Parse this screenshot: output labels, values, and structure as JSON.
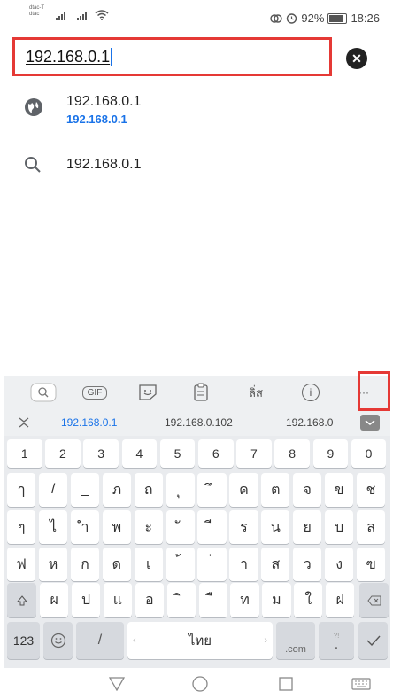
{
  "status_bar": {
    "carrier_top": "dtac-T",
    "carrier_bottom": "dtac",
    "battery_percent": "92%",
    "time": "18:26",
    "icons": [
      "signal-icon",
      "wifi-icon",
      "link-icon",
      "alarm-icon",
      "battery-icon"
    ]
  },
  "url_bar": {
    "value": "192.168.0.1",
    "clear_icon": "clear-icon",
    "highlight_color": "#e53935"
  },
  "suggestions": [
    {
      "icon": "globe-icon",
      "title": "192.168.0.1",
      "url": "192.168.0.1"
    },
    {
      "icon": "search-icon",
      "title": "192.168.0.1"
    }
  ],
  "keyboard": {
    "toolbar": {
      "gif_label": "GIF",
      "translate_label": "ลิ่ส",
      "info_label": "i",
      "more_label": "···",
      "icons": [
        "search-icon",
        "gif-icon",
        "sticker-icon",
        "clipboard-icon",
        "translate-icon",
        "info-icon",
        "more-icon"
      ]
    },
    "predictions": [
      "192.168.0.1",
      "192.168.0.102",
      "192.168.0.1"
    ],
    "number_row": [
      "1",
      "2",
      "3",
      "4",
      "5",
      "6",
      "7",
      "8",
      "9",
      "0"
    ],
    "row1": [
      "ๅ",
      "/",
      "_",
      "ภ",
      "ถ",
      "ุ",
      "ึ",
      "ค",
      "ต",
      "จ",
      "ข",
      "ช"
    ],
    "row2": [
      "ๆ",
      "ไ",
      "ำ",
      "พ",
      "ะ",
      "ั",
      "ี",
      "ร",
      "น",
      "ย",
      "บ",
      "ล"
    ],
    "row3": [
      "ฟ",
      "ห",
      "ก",
      "ด",
      "เ",
      "้",
      "่",
      "า",
      "ส",
      "ว",
      "ง",
      "ฃ"
    ],
    "row4": [
      "ผ",
      "ป",
      "แ",
      "อ",
      "ิ",
      "ื",
      "ท",
      "ม",
      "ใ",
      "ฝ"
    ],
    "bottom": {
      "numbers_label": "123",
      "slash_label": "/",
      "space_label": "ไทย",
      "com_label": ".com",
      "period_label": ".",
      "period_hint": "?!",
      "done_icon": "check-icon"
    },
    "accent_color": "#1a73e8",
    "highlight_color": "#e53935"
  },
  "nav_bar": {
    "icons": [
      "back-icon",
      "home-icon",
      "recents-icon",
      "keyboard-hide-icon"
    ]
  }
}
